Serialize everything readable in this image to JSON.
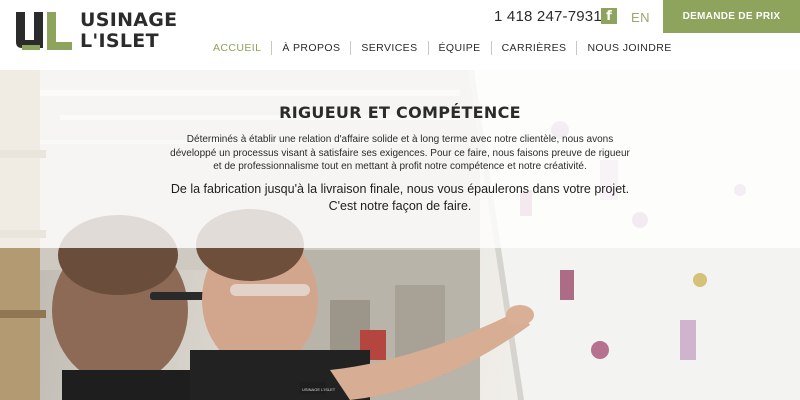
{
  "brand": {
    "name_line1": "USINAGE",
    "name_line2": "L'ISLET",
    "accent": "#8ea35c"
  },
  "header": {
    "phone": "1 418 247-7931",
    "facebook_icon": "f",
    "language": "EN",
    "cta_label": "DEMANDE DE PRIX"
  },
  "nav": {
    "items": [
      {
        "label": "ACCUEIL",
        "active": true
      },
      {
        "label": "À PROPOS"
      },
      {
        "label": "SERVICES"
      },
      {
        "label": "ÉQUIPE"
      },
      {
        "label": "CARRIÈRES"
      },
      {
        "label": "NOUS JOINDRE"
      }
    ]
  },
  "hero": {
    "title": "RIGUEUR ET COMPÉTENCE",
    "paragraph": "Déterminés à établir une relation d'affaire solide et à long terme avec notre clientèle, nous avons développé un processus visant à satisfaire ses exigences. Pour ce faire, nous faisons preuve de rigueur et de professionnalisme tout en mettant à profit notre compétence et notre créativité.",
    "lead_line1": "De la fabrication jusqu'à la livraison finale, nous vous épaulerons dans votre projet.",
    "lead_line2": "C'est notre façon de faire.",
    "shirt_logo": "USINAGE L'ISLET"
  }
}
